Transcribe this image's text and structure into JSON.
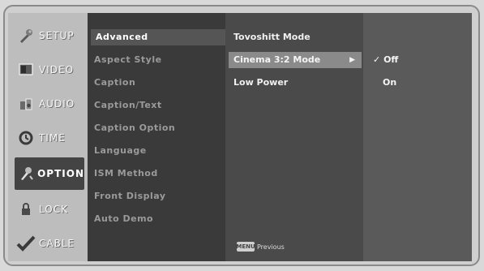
{
  "left_menu": {
    "items": [
      {
        "label": "SETUP",
        "icon": "wrench-icon"
      },
      {
        "label": "VIDEO",
        "icon": "screen-icon"
      },
      {
        "label": "AUDIO",
        "icon": "speaker-icon"
      },
      {
        "label": "TIME",
        "icon": "clock-icon"
      },
      {
        "label": "OPTION",
        "icon": "tools-icon"
      },
      {
        "label": "LOCK",
        "icon": "lock-icon"
      },
      {
        "label": "CABLE",
        "icon": "check-icon"
      }
    ]
  },
  "option_menu": {
    "items": [
      "Advanced",
      "Aspect Style",
      "Caption",
      "Caption/Text",
      "Caption Option",
      "Language",
      "ISM Method",
      "Front Display",
      "Auto Demo"
    ]
  },
  "advanced_menu": {
    "items": [
      "Tovoshitt Mode",
      "Cinema 3:2 Mode",
      "Low Power"
    ],
    "arrow": "▶"
  },
  "value_menu": {
    "check": "✓",
    "items": [
      "Off",
      "On"
    ]
  },
  "footer": {
    "key_label": "MENU",
    "action_label": "Previous"
  }
}
